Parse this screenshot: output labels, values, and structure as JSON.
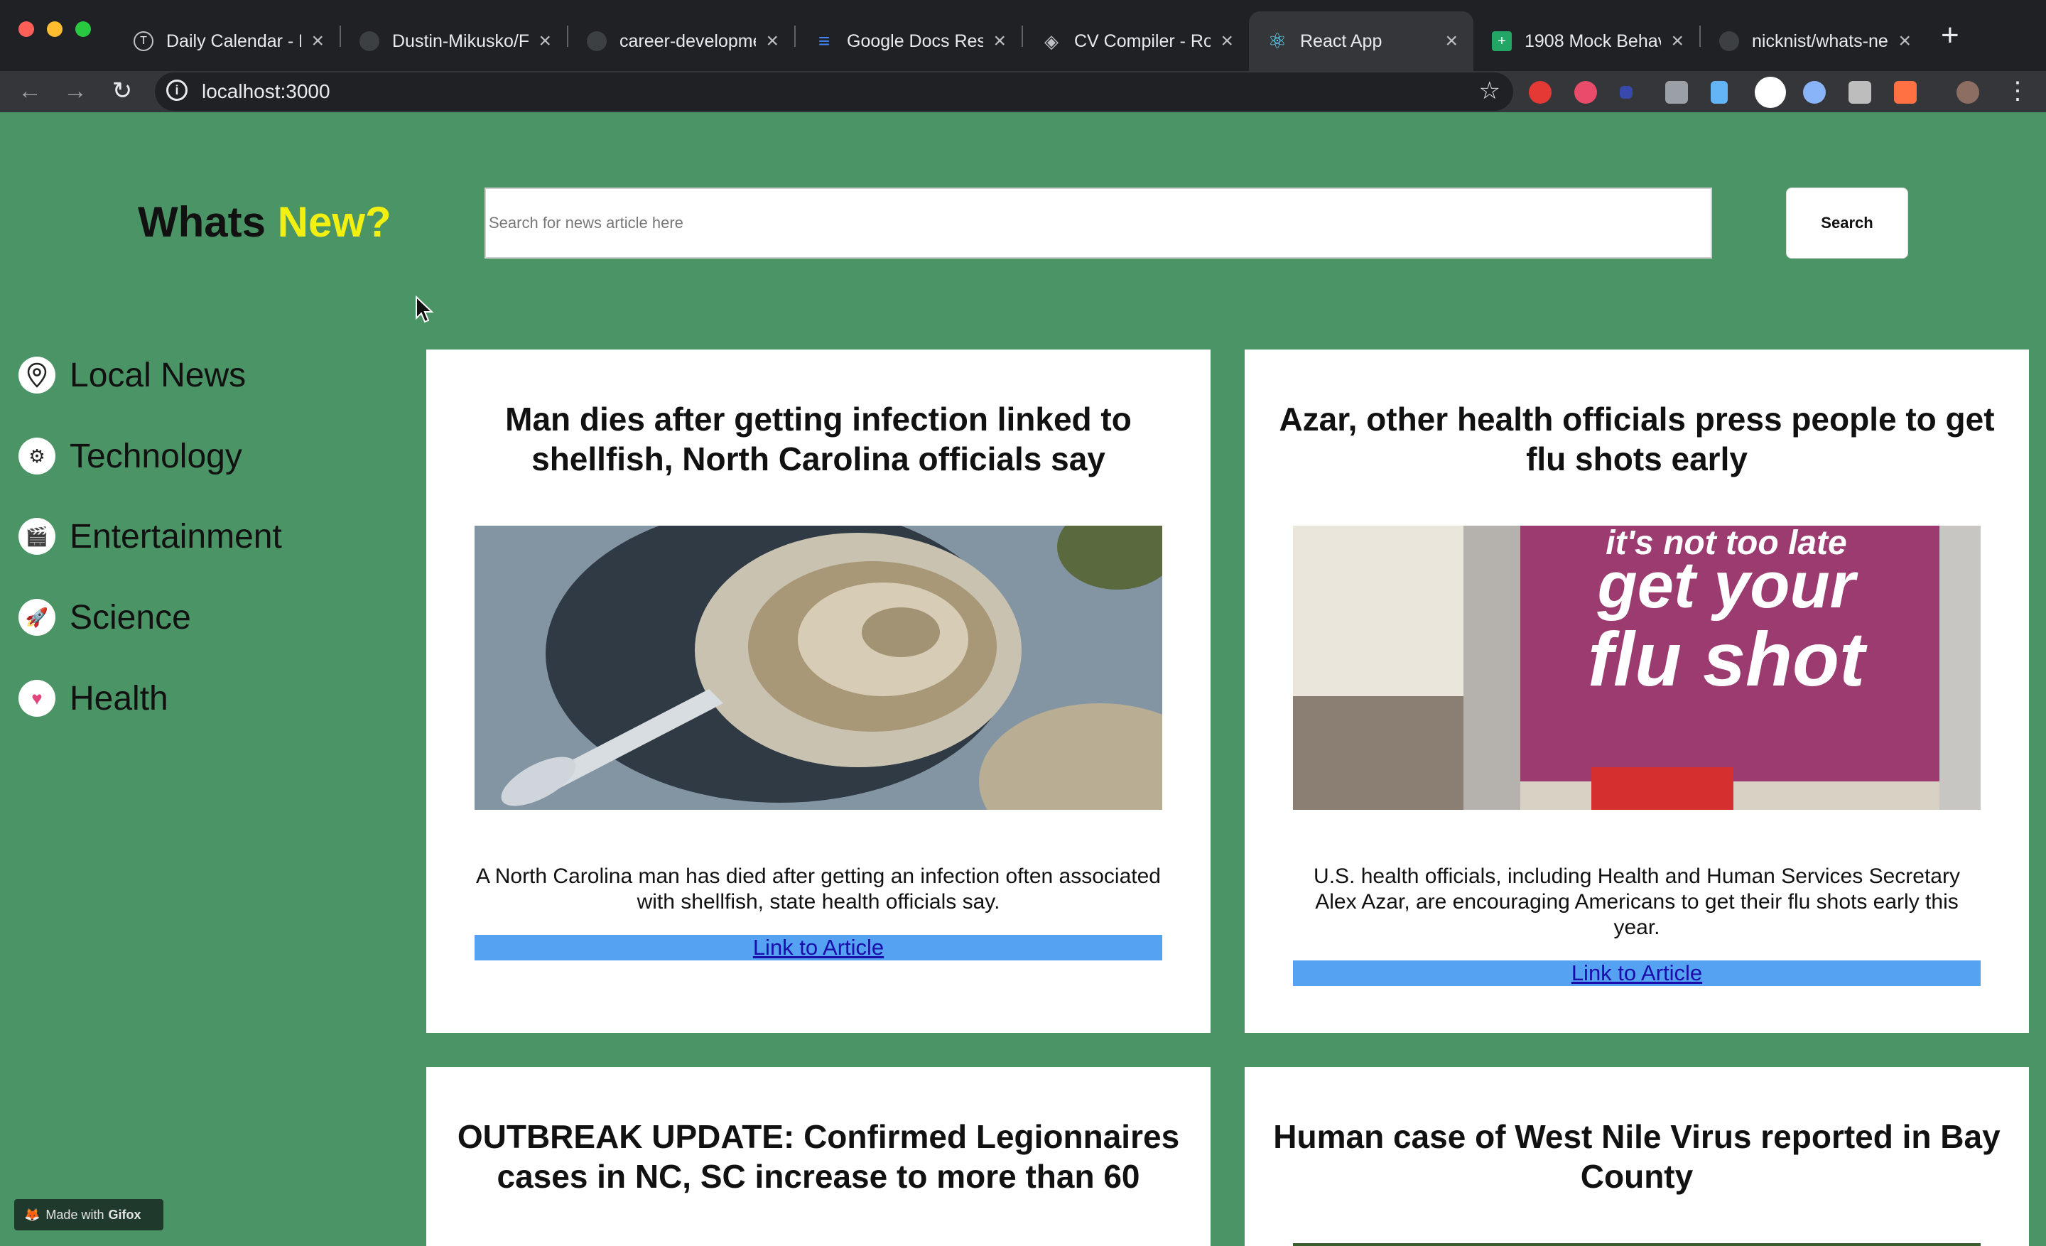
{
  "browser": {
    "tabs": [
      {
        "title": "Daily Calendar - F",
        "icon": "timely-icon"
      },
      {
        "title": "Dustin-Mikusko/F",
        "icon": "github-icon"
      },
      {
        "title": "career-developme",
        "icon": "github-icon"
      },
      {
        "title": "Google Docs Res",
        "icon": "filter-icon"
      },
      {
        "title": "CV Compiler - Ro",
        "icon": "layers-icon"
      },
      {
        "title": "React App",
        "icon": "react-icon",
        "active": true
      },
      {
        "title": "1908 Mock Behav",
        "icon": "sheets-icon"
      },
      {
        "title": "nicknist/whats-ne",
        "icon": "github-icon"
      }
    ],
    "tab_close_glyph": "×",
    "new_tab_glyph": "+",
    "url": "localhost:3000"
  },
  "app": {
    "brand_prefix": "Whats",
    "brand_accent": "New?",
    "search": {
      "placeholder": "Search for news article here",
      "button_label": "Search"
    },
    "sidebar": {
      "items": [
        {
          "label": "Local News",
          "icon": "map-pin-icon"
        },
        {
          "label": "Technology",
          "icon": "brain-gear-icon"
        },
        {
          "label": "Entertainment",
          "icon": "clapperboard-icon"
        },
        {
          "label": "Science",
          "icon": "rocket-icon"
        },
        {
          "label": "Health",
          "icon": "heart-icon"
        }
      ]
    },
    "articles": [
      {
        "title": "Man dies after getting infection linked to shellfish, North Carolina officials say",
        "description": "A North Carolina man has died after getting an infection often associated with shellfish, state health officials say.",
        "link_label": "Link to Article",
        "image": "oysters-photo"
      },
      {
        "title": "Azar, other health officials press people to get flu shots early",
        "description": "U.S. health officials, including Health and Human Services Secretary Alex Azar, are encouraging Americans to get their flu shots early this year.",
        "link_label": "Link to Article",
        "image": "flu-shot-sign-photo",
        "image_text": [
          "it's not too late",
          "get your",
          "flu shot"
        ]
      },
      {
        "title": "OUTBREAK UPDATE: Confirmed Legionnaires cases in NC, SC increase to more than 60"
      },
      {
        "title": "Human case of West Nile Virus reported in Bay County"
      }
    ],
    "watermark": {
      "prefix": "Made with",
      "brand": "Gifox"
    }
  },
  "colors": {
    "page_green": "#4a9466",
    "accent_yellow": "#f2ef12",
    "link_bar": "#55a2f2"
  }
}
